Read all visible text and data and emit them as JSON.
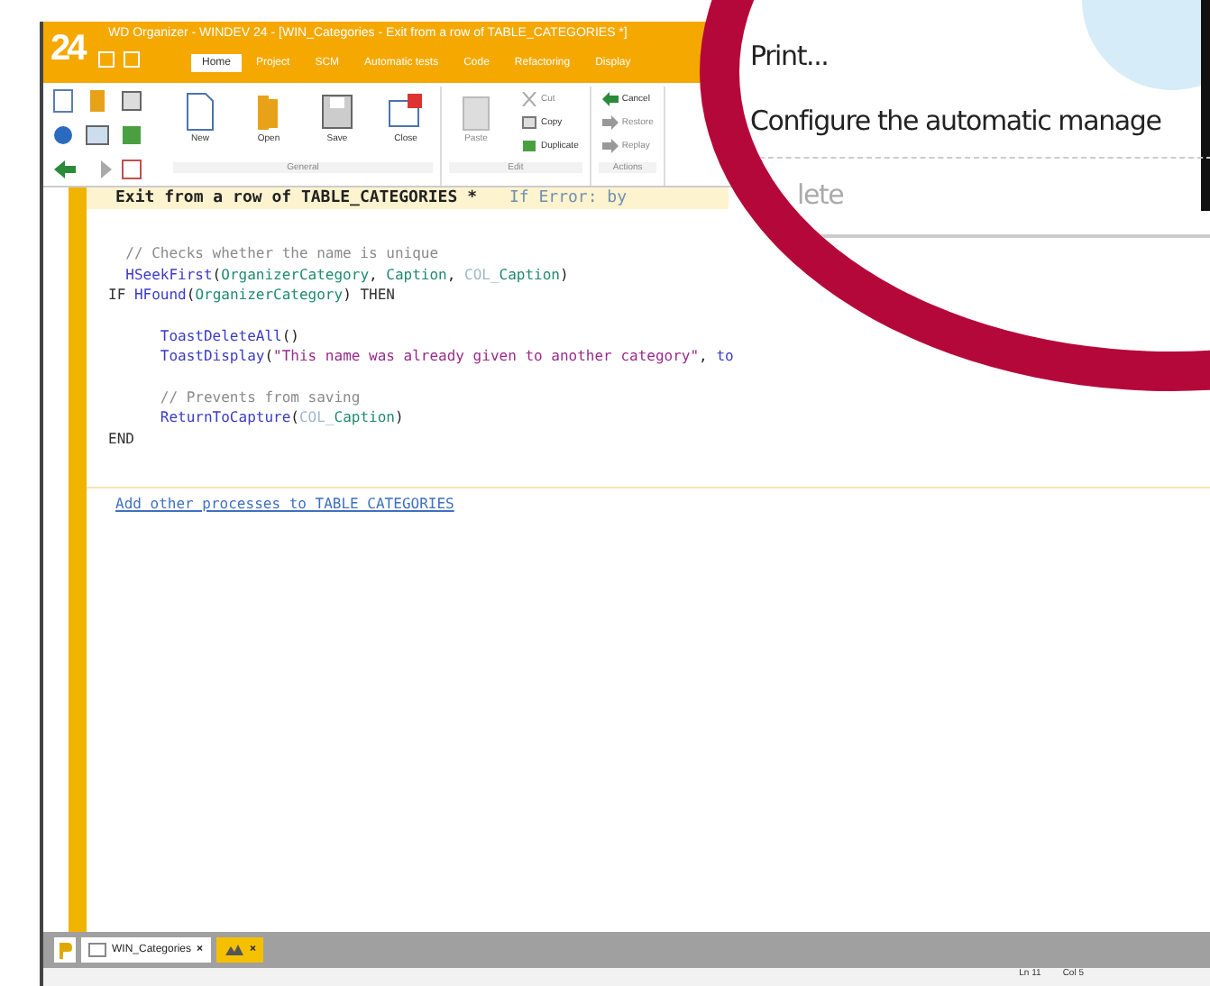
{
  "window": {
    "logo": "24",
    "title": "WD Organizer - WINDEV 24 - [WIN_Categories - Exit from a row of TABLE_CATEGORIES *]"
  },
  "tabs": [
    {
      "label": "Home",
      "selected": true
    },
    {
      "label": "Project",
      "selected": false
    },
    {
      "label": "SCM",
      "selected": false
    },
    {
      "label": "Automatic tests",
      "selected": false
    },
    {
      "label": "Code",
      "selected": false
    },
    {
      "label": "Refactoring",
      "selected": false
    },
    {
      "label": "Display",
      "selected": false
    }
  ],
  "ribbon_groups": [
    {
      "label": "General",
      "buttons": [
        {
          "kind": "large",
          "label": "New",
          "disabled": false
        },
        {
          "kind": "large",
          "label": "Open",
          "disabled": false
        },
        {
          "kind": "large",
          "label": "Save",
          "disabled": false
        },
        {
          "kind": "large",
          "label": "Close",
          "disabled": false
        }
      ]
    },
    {
      "label": "Edit",
      "buttons": [
        {
          "kind": "large",
          "label": "Paste",
          "disabled": true
        },
        {
          "kind": "small",
          "label": "Cut",
          "disabled": true
        },
        {
          "kind": "small",
          "label": "Copy",
          "disabled": false
        },
        {
          "kind": "small",
          "label": "Duplicate",
          "disabled": false
        }
      ]
    },
    {
      "label": "Actions",
      "buttons": [
        {
          "kind": "small",
          "label": "Cancel",
          "disabled": false
        },
        {
          "kind": "small",
          "label": "Restore",
          "disabled": true
        },
        {
          "kind": "small",
          "label": "Replay",
          "disabled": true
        }
      ]
    }
  ],
  "editor": {
    "header": "Exit from a row of TABLE_CATEGORIES *",
    "header_hint": "If Error: by",
    "blocks": [
      [
        [
          {
            "kind": "comment",
            "text": "  // Checks whether the name is unique"
          }
        ],
        [
          {
            "kind": "func",
            "text": "  HSeekFirst"
          },
          {
            "kind": "plain",
            "text": "("
          },
          {
            "kind": "ident",
            "text": "OrganizerCategory"
          },
          {
            "kind": "plain",
            "text": ", "
          },
          {
            "kind": "ident",
            "text": "Caption"
          },
          {
            "kind": "plain",
            "text": ", "
          },
          {
            "kind": "const",
            "text": "COL_"
          },
          {
            "kind": "ident",
            "text": "Caption"
          },
          {
            "kind": "plain",
            "text": ")"
          }
        ],
        [
          {
            "kind": "keyword",
            "text": "IF "
          },
          {
            "kind": "func",
            "text": "HFound"
          },
          {
            "kind": "plain",
            "text": "("
          },
          {
            "kind": "ident",
            "text": "OrganizerCategory"
          },
          {
            "kind": "plain",
            "text": ") "
          },
          {
            "kind": "keyword",
            "text": "THEN"
          }
        ]
      ],
      [
        [
          {
            "kind": "func",
            "text": "      ToastDeleteAll"
          },
          {
            "kind": "plain",
            "text": "()"
          }
        ],
        [
          {
            "kind": "func",
            "text": "      ToastDisplay"
          },
          {
            "kind": "plain",
            "text": "("
          },
          {
            "kind": "string",
            "text": "\"This name was already given to another category\""
          },
          {
            "kind": "plain",
            "text": ", "
          },
          {
            "kind": "func",
            "text": "to"
          }
        ]
      ],
      [
        [
          {
            "kind": "comment",
            "text": "      // Prevents from saving"
          }
        ],
        [
          {
            "kind": "func",
            "text": "      ReturnToCapture"
          },
          {
            "kind": "plain",
            "text": "("
          },
          {
            "kind": "const",
            "text": "COL_"
          },
          {
            "kind": "ident",
            "text": "Caption"
          },
          {
            "kind": "plain",
            "text": ")"
          }
        ],
        [
          {
            "kind": "keyword",
            "text": "END"
          }
        ]
      ]
    ],
    "link": "Add other processes to TABLE_CATEGORIES"
  },
  "document_tabs": [
    {
      "label": "WIN_Categories",
      "close": "×",
      "selected": false
    },
    {
      "close": "×",
      "selected": true
    }
  ],
  "status_bar": [
    "Ln 11",
    "Col 5"
  ],
  "magnifier": {
    "items": [
      {
        "label": "Print...",
        "disabled": false
      },
      {
        "label": "Configure the automatic manage",
        "disabled": false
      },
      {
        "label": "lete",
        "disabled": true
      }
    ]
  }
}
